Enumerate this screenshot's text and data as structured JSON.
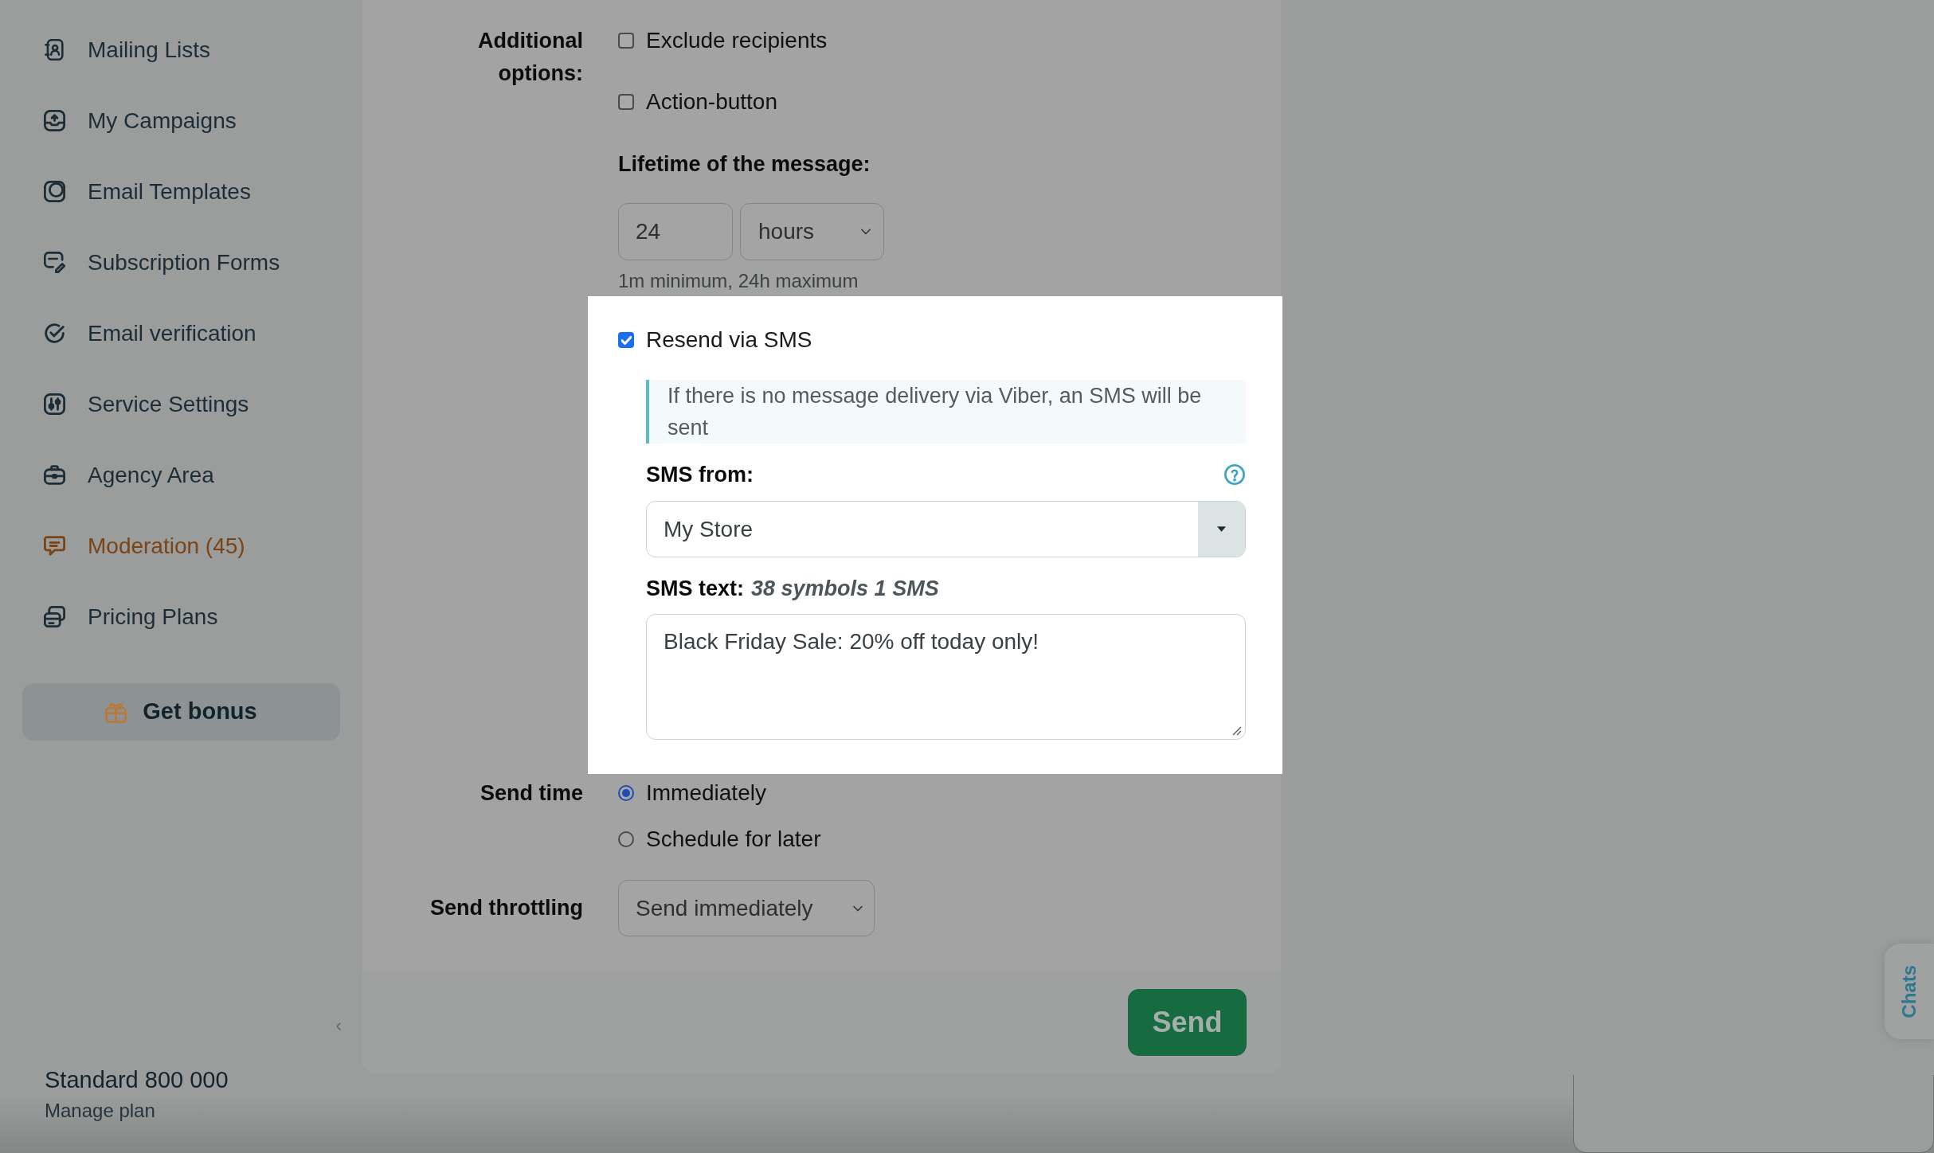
{
  "sidebar": {
    "items": [
      {
        "label": "Mailing Lists",
        "highlighted": false
      },
      {
        "label": "My Campaigns",
        "highlighted": false
      },
      {
        "label": "Email Templates",
        "highlighted": false
      },
      {
        "label": "Subscription Forms",
        "highlighted": false
      },
      {
        "label": "Email verification",
        "highlighted": false
      },
      {
        "label": "Service Settings",
        "highlighted": false
      },
      {
        "label": "Agency Area",
        "highlighted": false
      },
      {
        "label": "Moderation (45)",
        "highlighted": true
      },
      {
        "label": "Pricing Plans",
        "highlighted": false
      }
    ],
    "bonus_button": "Get bonus",
    "plan": {
      "name": "Standard 800 000",
      "link": "Manage plan"
    }
  },
  "form": {
    "additional_options": {
      "label": "Additional options:",
      "options": [
        {
          "label": "Exclude recipients",
          "checked": false
        },
        {
          "label": "Action-button",
          "checked": false
        }
      ]
    },
    "lifetime": {
      "label": "Lifetime of the message:",
      "value": "24",
      "unit": "hours",
      "hint": "1m minimum, 24h maximum"
    },
    "sms_fallback": {
      "label": "Resend via SMS",
      "checked": true,
      "note": "If there is no message delivery via Viber, an SMS will be sent",
      "from_label": "SMS from:",
      "from_value": "My Store",
      "text_label": "SMS text:",
      "text_counter": "38 symbols 1 SMS",
      "text_value": "Black Friday Sale: 20% off today only!"
    },
    "send_time": {
      "label": "Send time",
      "options": [
        {
          "label": "Immediately",
          "selected": true
        },
        {
          "label": "Schedule for later",
          "selected": false
        }
      ]
    },
    "throttling": {
      "label": "Send throttling",
      "value": "Send immediately"
    },
    "send_button": "Send"
  },
  "chats_tab": "Chats"
}
